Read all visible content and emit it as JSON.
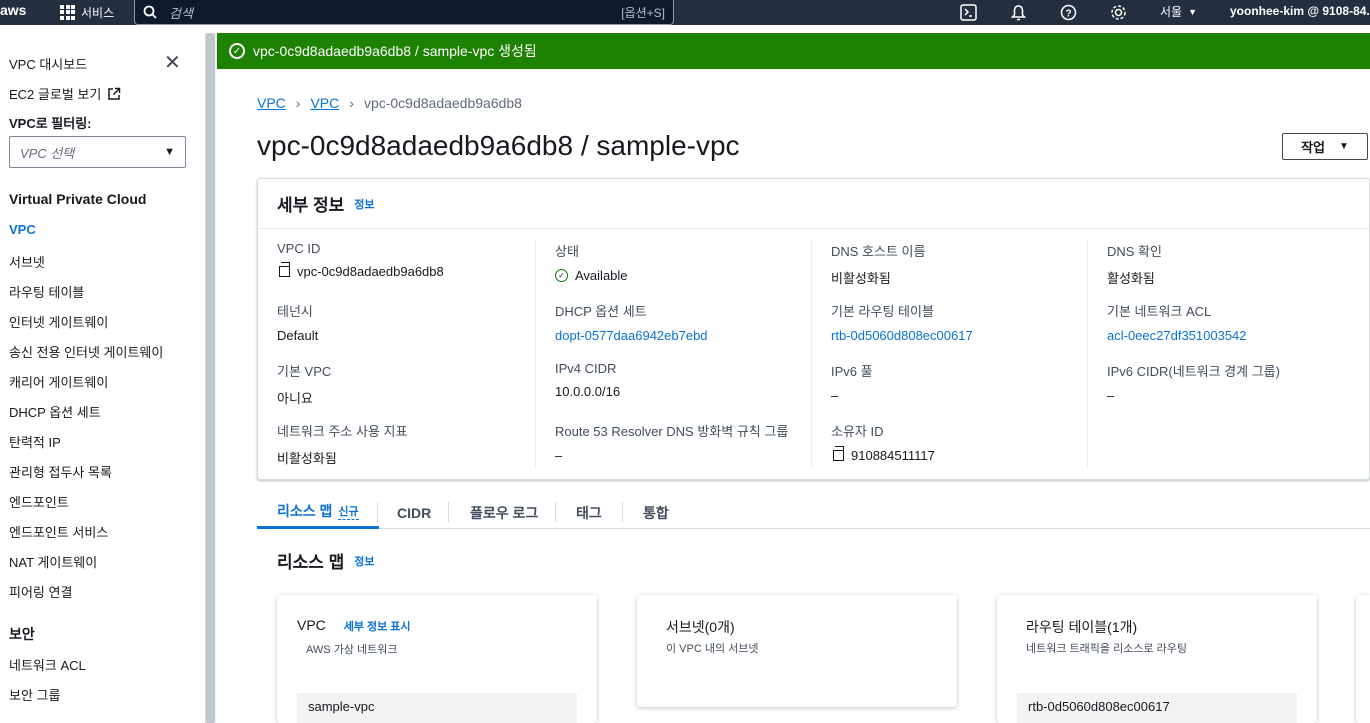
{
  "topnav": {
    "logo": "aws",
    "services_label": "서비스",
    "search_placeholder": "검색",
    "search_shortcut": "[옵션+S]",
    "region": "서울",
    "user": "yoonhee-kim @ 9108-84..."
  },
  "sidebar": {
    "dashboard": "VPC 대시보드",
    "ec2_global": "EC2 글로벌 보기",
    "filter_label": "VPC로 필터링:",
    "filter_placeholder": "VPC 선택",
    "section_vpc": "Virtual Private Cloud",
    "items": [
      "VPC",
      "서브넷",
      "라우팅 테이블",
      "인터넷 게이트웨이",
      "송신 전용 인터넷 게이트웨이",
      "캐리어 게이트웨이",
      "DHCP 옵션 세트",
      "탄력적 IP",
      "관리형 접두사 목록",
      "엔드포인트",
      "엔드포인트 서비스",
      "NAT 게이트웨이",
      "피어링 연결"
    ],
    "section_security": "보안",
    "security_items": [
      "네트워크 ACL",
      "보안 그룹"
    ]
  },
  "banner": {
    "text": "vpc-0c9d8adaedb9a6db8 / sample-vpc 생성됨"
  },
  "breadcrumb": [
    "VPC",
    "VPC",
    "vpc-0c9d8adaedb9a6db8"
  ],
  "page_title": "vpc-0c9d8adaedb9a6db8 / sample-vpc",
  "actions_label": "작업",
  "details": {
    "title": "세부 정보",
    "info": "정보",
    "vpc_id_k": "VPC ID",
    "vpc_id_v": "vpc-0c9d8adaedb9a6db8",
    "tenancy_k": "테넌시",
    "tenancy_v": "Default",
    "default_vpc_k": "기본 VPC",
    "default_vpc_v": "아니요",
    "net_usage_k": "네트워크 주소 사용 지표",
    "net_usage_v": "비활성화됨",
    "state_k": "상태",
    "state_v": "Available",
    "dhcp_k": "DHCP 옵션 세트",
    "dhcp_v": "dopt-0577daa6942eb7ebd",
    "ipv4_k": "IPv4 CIDR",
    "ipv4_v": "10.0.0.0/16",
    "r53_k": "Route 53 Resolver DNS 방화벽 규칙 그룹",
    "r53_v": "–",
    "dns_host_k": "DNS 호스트 이름",
    "dns_host_v": "비활성화됨",
    "main_rt_k": "기본 라우팅 테이블",
    "main_rt_v": "rtb-0d5060d808ec00617",
    "ipv6_pool_k": "IPv6 풀",
    "ipv6_pool_v": "–",
    "owner_k": "소유자 ID",
    "owner_v": "910884511117",
    "dns_res_k": "DNS 확인",
    "dns_res_v": "활성화됨",
    "main_acl_k": "기본 네트워크 ACL",
    "main_acl_v": "acl-0eec27df351003542",
    "ipv6_cidr_k": "IPv6 CIDR(네트워크 경계 그룹)",
    "ipv6_cidr_v": "–"
  },
  "tabs": {
    "resource_map": "리소스 맵",
    "new": "신규",
    "cidr": "CIDR",
    "flow_logs": "플로우 로그",
    "tags": "태그",
    "integration": "통합"
  },
  "resource_map": {
    "title": "리소스 맵",
    "info": "정보",
    "vpc_card": {
      "title": "VPC",
      "link": "세부 정보 표시",
      "sub": "AWS 가상 네트워크",
      "item": "sample-vpc"
    },
    "subnet_card": {
      "title": "서브넷(0개)",
      "sub": "이 VPC 내의 서브넷"
    },
    "rt_card": {
      "title": "라우팅 테이블(1개)",
      "sub": "네트워크 트래픽을 리소스로 라우팅",
      "item": "rtb-0d5060d808ec00617"
    }
  }
}
